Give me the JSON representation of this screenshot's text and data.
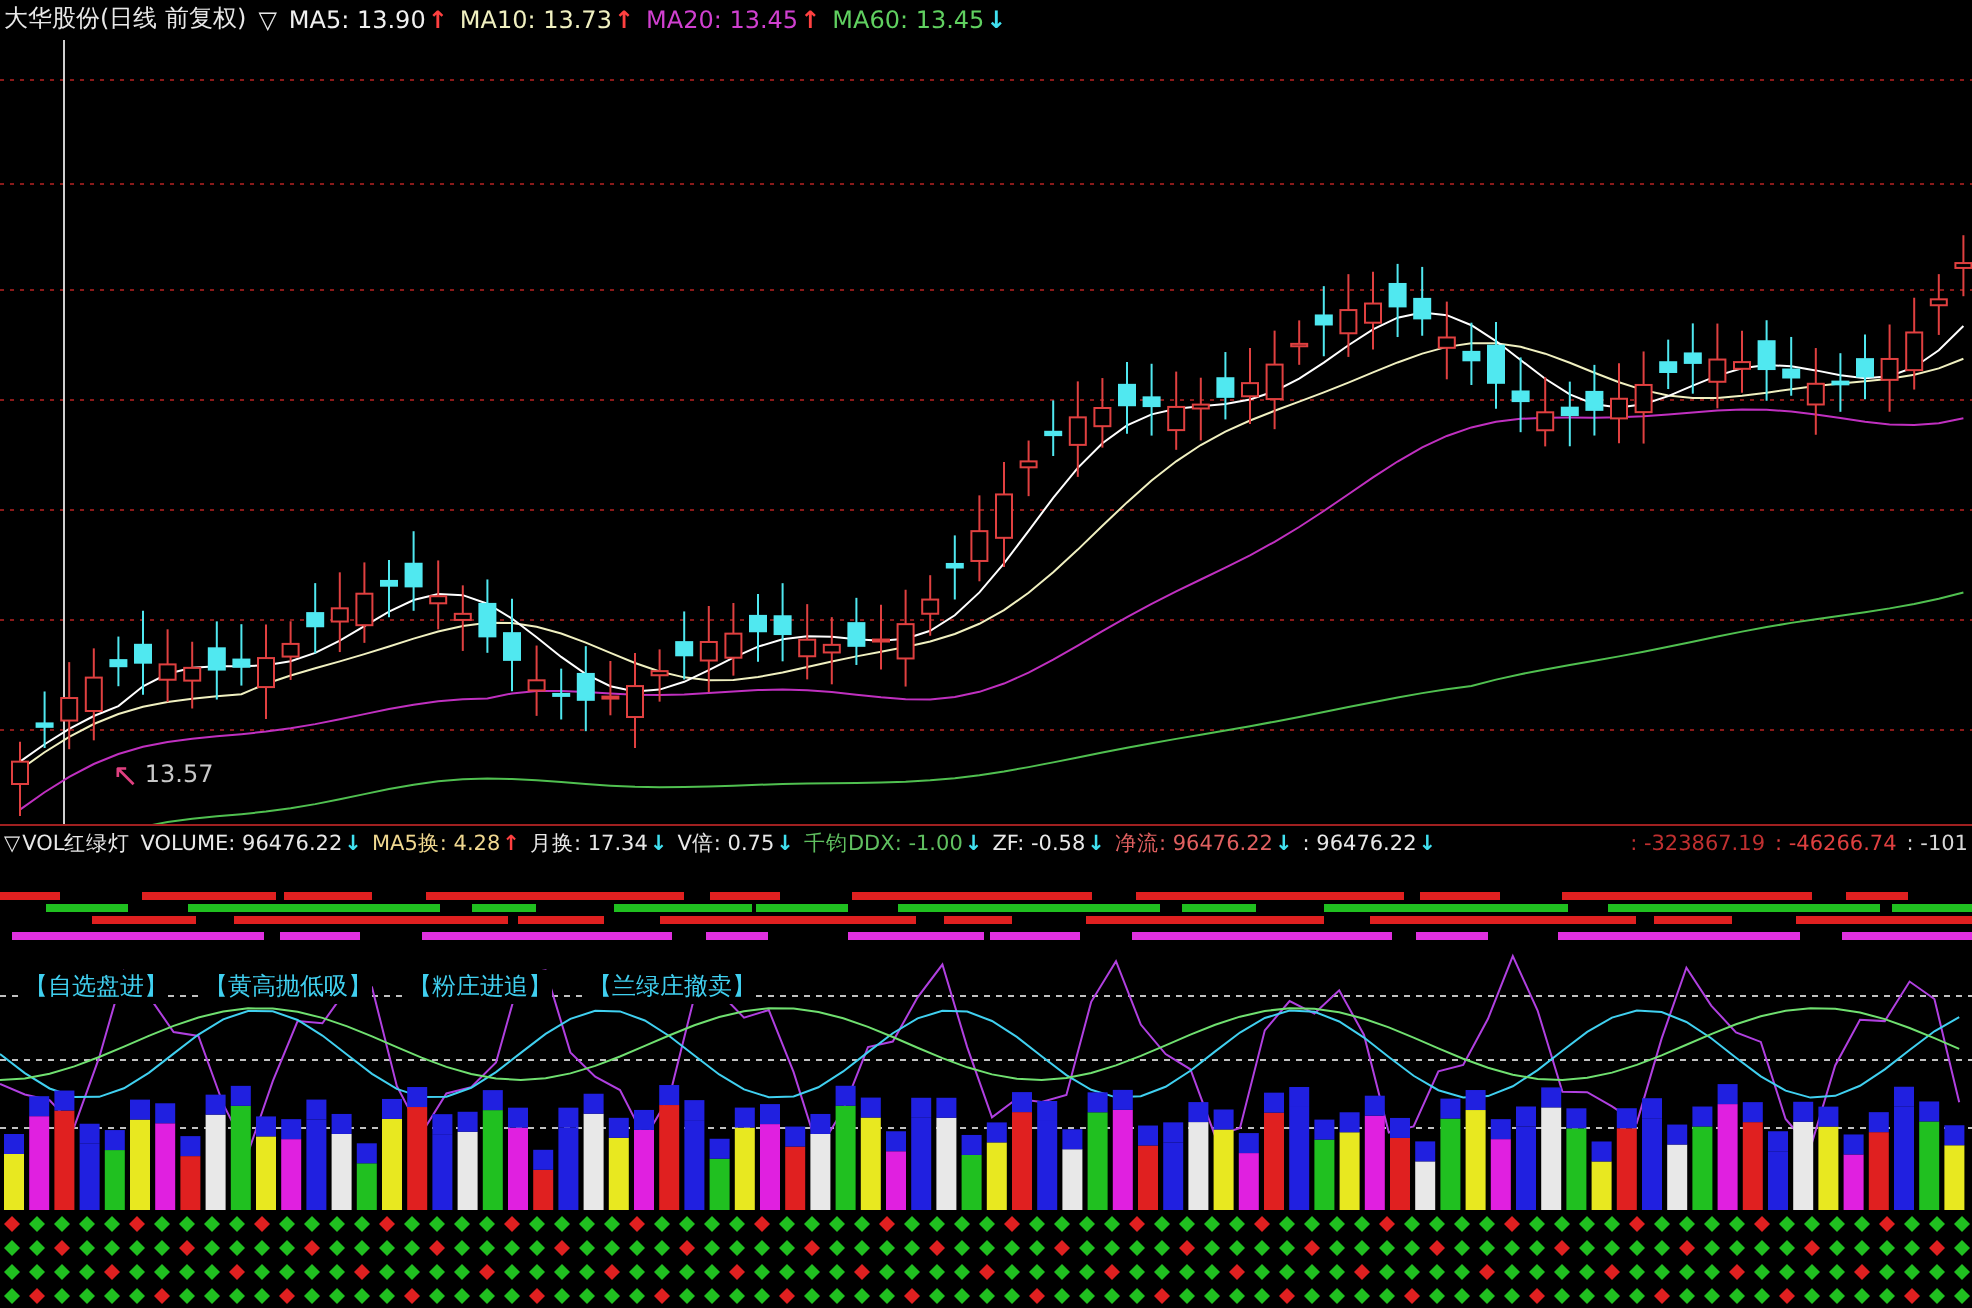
{
  "main_header": {
    "marker": "▽",
    "stock": "大华股份(日线 前复权)",
    "ma": [
      {
        "label": "MA5: 13.90",
        "color": "#f0f0f0",
        "arrow": {
          "text": "↑",
          "color": "#ff4040"
        }
      },
      {
        "label": "MA10: 13.73",
        "color": "#f0f0c0",
        "arrow": {
          "text": "↑",
          "color": "#ff4040"
        }
      },
      {
        "label": "MA20: 13.45",
        "color": "#d040d0",
        "arrow": {
          "text": "↑",
          "color": "#ff4040"
        }
      },
      {
        "label": "MA60: 13.45",
        "color": "#60d060",
        "arrow": {
          "text": "↓",
          "color": "#40e0f0"
        }
      }
    ]
  },
  "price_label": {
    "arrow": "↖",
    "text": "13.57"
  },
  "indicator_header": {
    "marker": "▽",
    "name": "VOL红绿灯",
    "items": [
      {
        "label": "VOLUME: 96476.22",
        "color": "#e8e8e8",
        "arrow": {
          "text": "↓",
          "color": "#40e0f0"
        }
      },
      {
        "label": "MA5换: 4.28",
        "color": "#f0d890",
        "arrow": {
          "text": "↑",
          "color": "#ff4040"
        }
      },
      {
        "label": "月换: 17.34",
        "color": "#e8e8e8",
        "arrow": {
          "text": "↓",
          "color": "#40e0f0"
        }
      },
      {
        "label": "V倍: 0.75",
        "color": "#e8e8e8",
        "arrow": {
          "text": "↓",
          "color": "#40e0f0"
        }
      },
      {
        "label": "千钧DDX: -1.00",
        "color": "#60c060",
        "arrow": {
          "text": "↓",
          "color": "#40e0f0"
        }
      },
      {
        "label": "ZF: -0.58",
        "color": "#e8e8e8",
        "arrow": {
          "text": "↓",
          "color": "#40e0f0"
        }
      },
      {
        "label": "净流: 96476.22",
        "color": "#e06060",
        "arrow": {
          "text": "↓",
          "color": "#40e0f0"
        }
      },
      {
        "label": ": 96476.22",
        "color": "#e8e8e8",
        "arrow": {
          "text": "↓",
          "color": "#40e0f0"
        }
      }
    ],
    "values": [
      {
        "text": ": -323867.19",
        "color": "#c03030"
      },
      {
        "text": ": -46266.74",
        "color": "#e04040"
      },
      {
        "text": ": -101",
        "color": "#d8d8d8"
      }
    ]
  },
  "signal_labels": [
    "【自选盘进】",
    "【黄高抛低吸】",
    "【粉庄进追】",
    "【兰绿庄撤卖】"
  ]
}
